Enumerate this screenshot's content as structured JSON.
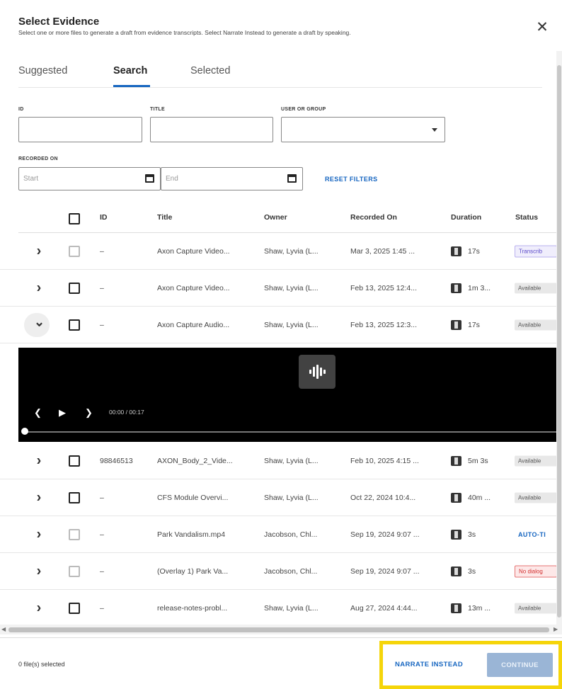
{
  "dialog": {
    "title": "Select Evidence",
    "subtitle": "Select one or more files to generate a draft from evidence transcripts. Select Narrate Instead to generate a draft by speaking.",
    "close_glyph": "✕"
  },
  "tabs": [
    {
      "label": "Suggested",
      "active": false
    },
    {
      "label": "Search",
      "active": true
    },
    {
      "label": "Selected",
      "active": false
    }
  ],
  "filters": {
    "id_label": "ID",
    "title_label": "TITLE",
    "user_label": "USER OR GROUP",
    "recorded_label": "RECORDED ON",
    "start_placeholder": "Start",
    "end_placeholder": "End",
    "reset_label": "RESET FILTERS"
  },
  "table": {
    "columns": [
      "ID",
      "Title",
      "Owner",
      "Recorded On",
      "Duration",
      "Status"
    ],
    "rows": [
      {
        "id": "–",
        "title": "Axon Capture Video...",
        "owner": "Shaw, Lyvia (L...",
        "recorded": "Mar 3, 2025 1:45 ...",
        "duration": "17s",
        "status": "Transcrib",
        "status_kind": "transcribing",
        "checkbox_dim": true,
        "expanded": false,
        "media": "video"
      },
      {
        "id": "–",
        "title": "Axon Capture Video...",
        "owner": "Shaw, Lyvia (L...",
        "recorded": "Feb 13, 2025 12:4...",
        "duration": "1m 3...",
        "status": "Available",
        "status_kind": "available",
        "checkbox_dim": false,
        "expanded": false,
        "media": "video"
      },
      {
        "id": "–",
        "title": "Axon Capture Audio...",
        "owner": "Shaw, Lyvia (L...",
        "recorded": "Feb 13, 2025 12:3...",
        "duration": "17s",
        "status": "Available",
        "status_kind": "available",
        "checkbox_dim": false,
        "expanded": true,
        "media": "audio"
      },
      {
        "id": "98846513",
        "title": "AXON_Body_2_Vide...",
        "owner": "Shaw, Lyvia (L...",
        "recorded": "Feb 10, 2025 4:15 ...",
        "duration": "5m 3s",
        "status": "Available",
        "status_kind": "available",
        "checkbox_dim": false,
        "expanded": false,
        "media": "video"
      },
      {
        "id": "–",
        "title": "CFS Module Overvi...",
        "owner": "Shaw, Lyvia (L...",
        "recorded": "Oct 22, 2024 10:4...",
        "duration": "40m ...",
        "status": "Available",
        "status_kind": "available",
        "checkbox_dim": false,
        "expanded": false,
        "media": "video"
      },
      {
        "id": "–",
        "title": "Park Vandalism.mp4",
        "owner": "Jacobson, Chl...",
        "recorded": "Sep 19, 2024 9:07 ...",
        "duration": "3s",
        "status": "AUTO-TI",
        "status_kind": "auto",
        "checkbox_dim": true,
        "expanded": false,
        "media": "video"
      },
      {
        "id": "–",
        "title": "(Overlay 1) Park Va...",
        "owner": "Jacobson, Chl...",
        "recorded": "Sep 19, 2024 9:07 ...",
        "duration": "3s",
        "status": "No dialog",
        "status_kind": "nodialog",
        "checkbox_dim": true,
        "expanded": false,
        "media": "video"
      },
      {
        "id": "–",
        "title": "release-notes-probl...",
        "owner": "Shaw, Lyvia (L...",
        "recorded": "Aug 27, 2024 4:44...",
        "duration": "13m ...",
        "status": "Available",
        "status_kind": "available",
        "checkbox_dim": false,
        "expanded": false,
        "media": "video"
      }
    ]
  },
  "player": {
    "current_time": "00:00",
    "separator": "/",
    "total_time": "00:17",
    "progress": 0
  },
  "footer": {
    "selected_text": "0 file(s) selected",
    "narrate_label": "NARRATE INSTEAD",
    "continue_label": "CONTINUE"
  },
  "colors": {
    "accent": "#1565c0",
    "highlight": "#f5d50a",
    "continue_disabled": "#9ab5d6"
  }
}
